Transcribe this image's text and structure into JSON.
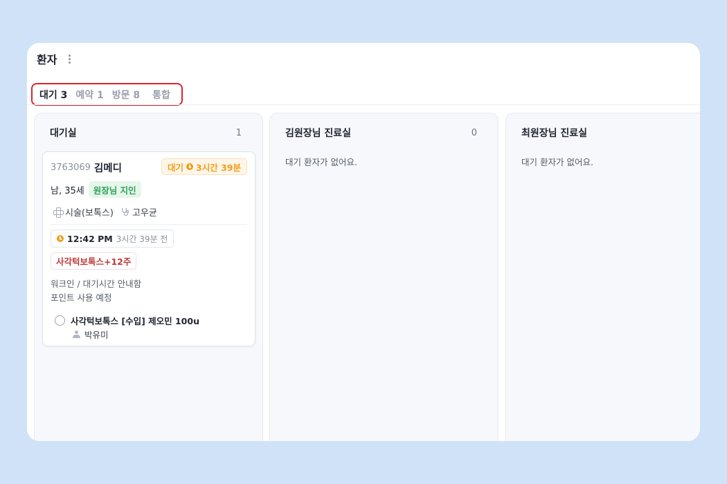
{
  "header": {
    "title": "환자"
  },
  "tabs": [
    {
      "label": "대기 3",
      "active": true
    },
    {
      "label": "예약 1",
      "active": false
    },
    {
      "label": "방문 8",
      "active": false
    },
    {
      "label": "통합",
      "active": false
    }
  ],
  "columns": [
    {
      "title": "대기실",
      "count": "1",
      "card": {
        "chart_no": "3763069",
        "name": "김메디",
        "status": "대기",
        "status_time": "3시간 39분",
        "gender_age": "남, 35세",
        "tag": "원장님 지인",
        "treatment": "시술(보톡스)",
        "doctor": "고우균",
        "time": "12:42 PM",
        "time_ago": "3시간 39분 전",
        "procedure": "사각턱보톡스+12주",
        "memo_line1": "워크인 / 대기시간 안내함",
        "memo_line2": "포인트 사용 예정",
        "task": "사각턱보톡스 [수입] 제오민 100u",
        "assignee": "박유미"
      }
    },
    {
      "title": "김원장님 진료실",
      "count": "0",
      "empty": "대기 환자가 없어요."
    },
    {
      "title": "최원장님 진료실",
      "count": "",
      "empty": "대기 환자가 없어요."
    }
  ],
  "colors": {
    "background": "#cfe2f7",
    "highlight_border": "#d9232d",
    "status_orange": "#f39c1b",
    "tag_green": "#2fa35a",
    "procedure_red": "#c33a3a"
  }
}
